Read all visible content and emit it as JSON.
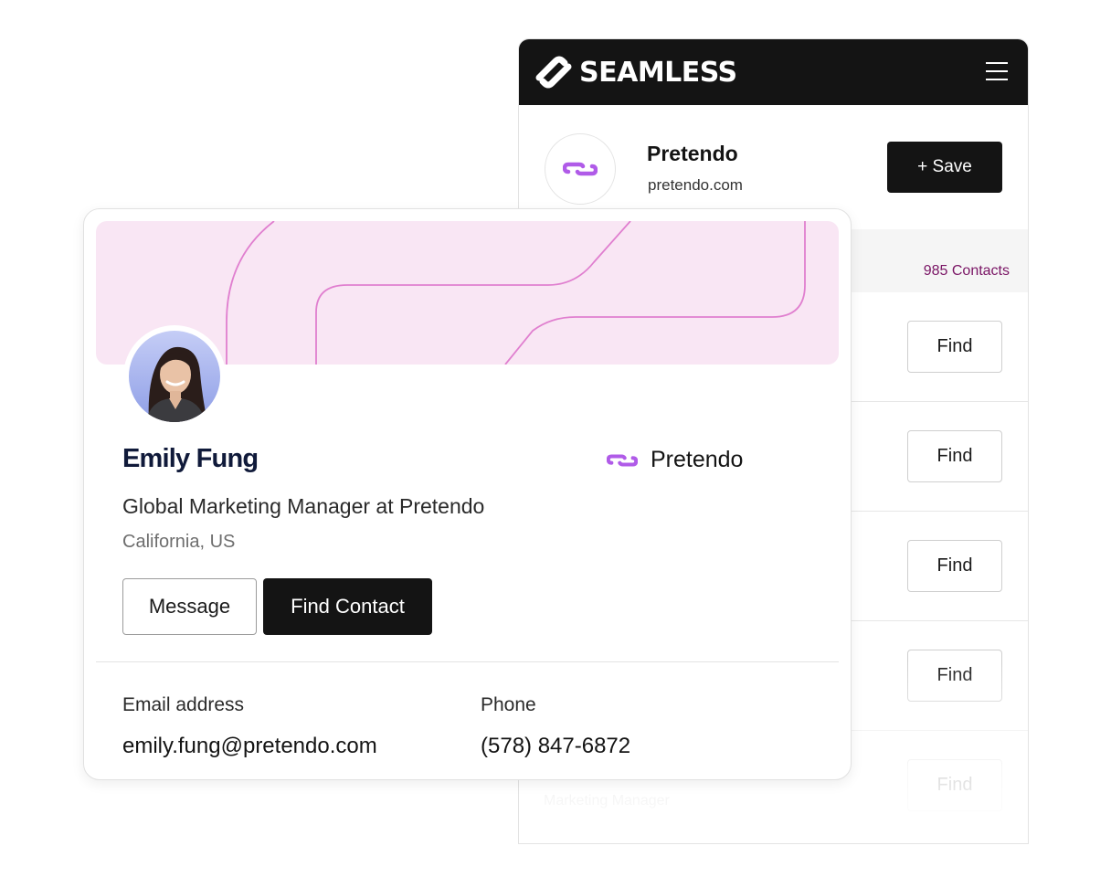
{
  "extension": {
    "brand": "SEAMLESS",
    "company": {
      "name": "Pretendo",
      "domain": "pretendo.com",
      "save_label": "+ Save"
    },
    "contacts_count": "985 Contacts",
    "rows": [
      {
        "button": "Find",
        "subtitle": ""
      },
      {
        "button": "Find",
        "subtitle": ""
      },
      {
        "button": "Find",
        "subtitle": ""
      },
      {
        "button": "Find",
        "subtitle": ""
      },
      {
        "button": "Find",
        "subtitle": "Marketing Manager"
      }
    ]
  },
  "profile": {
    "name": "Emily Fung",
    "company": "Pretendo",
    "title": "Global Marketing Manager at Pretendo",
    "location": "California, US",
    "message_label": "Message",
    "find_contact_label": "Find Contact",
    "email_label": "Email address",
    "email": "emily.fung@pretendo.com",
    "phone_label": "Phone",
    "phone": "(578) 847-6872"
  },
  "colors": {
    "dark": "#141414",
    "accent_purple": "#b05be8",
    "banner_pink": "#f9e6f4",
    "banner_line": "#e07fcf",
    "count_magenta": "#7a1565"
  },
  "icons": [
    "seamless-logo-icon",
    "menu-icon",
    "pretendo-logo-icon"
  ]
}
